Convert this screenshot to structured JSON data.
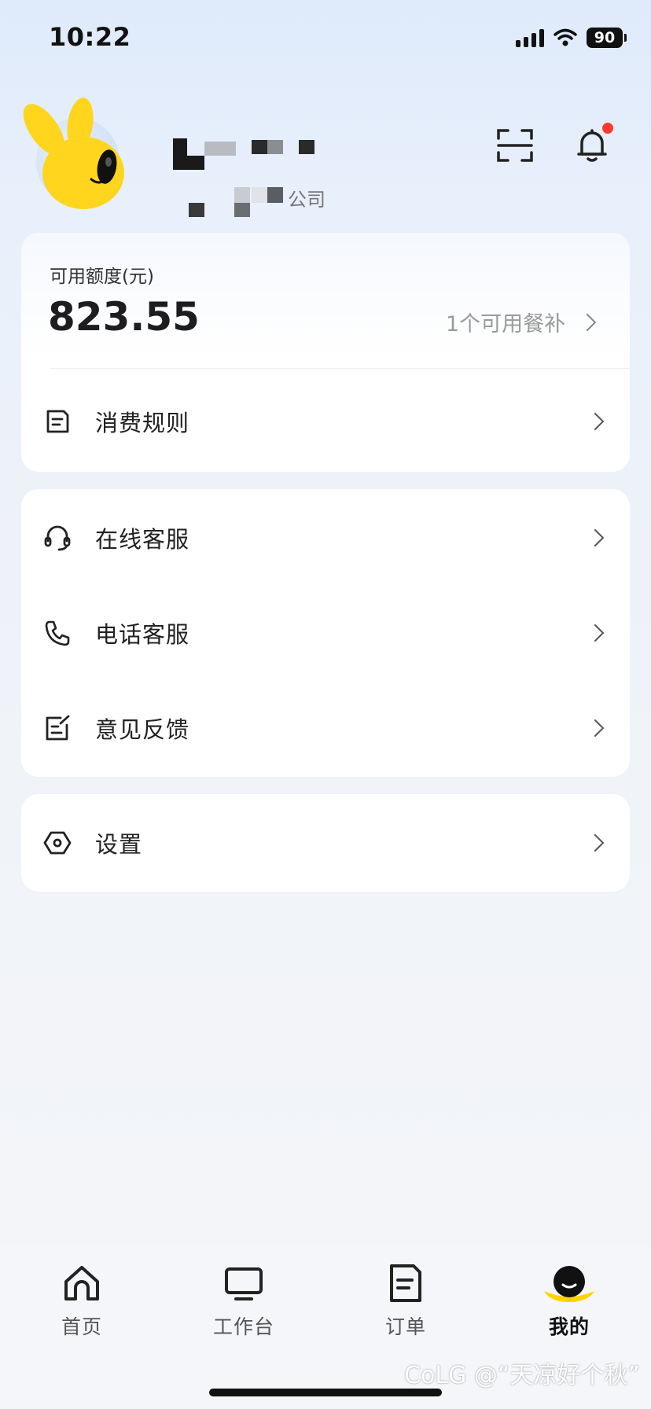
{
  "status_bar": {
    "time": "10:22",
    "battery": "90"
  },
  "profile": {
    "company_suffix": "公司"
  },
  "balance_card": {
    "label": "可用额度(元)",
    "amount": "823.55",
    "meal_allowance": "1个可用餐补",
    "rule_item": {
      "label": "消费规则",
      "icon": "document-icon"
    }
  },
  "service_card": {
    "items": [
      {
        "label": "在线客服",
        "icon": "headset-icon"
      },
      {
        "label": "电话客服",
        "icon": "phone-icon"
      },
      {
        "label": "意见反馈",
        "icon": "feedback-icon"
      }
    ]
  },
  "settings_card": {
    "label": "设置",
    "icon": "hexagon-settings-icon"
  },
  "tab_bar": {
    "tabs": [
      {
        "label": "首页",
        "icon": "home-icon",
        "active": false
      },
      {
        "label": "工作台",
        "icon": "monitor-icon",
        "active": false
      },
      {
        "label": "订单",
        "icon": "order-icon",
        "active": false
      },
      {
        "label": "我的",
        "icon": "me-icon",
        "active": true
      }
    ]
  },
  "watermark": "CoLG @“天凉好个秋”",
  "colors": {
    "accent": "#ffd400",
    "badge": "#ff3b30",
    "text": "#222222",
    "muted": "#9a9a9a"
  }
}
